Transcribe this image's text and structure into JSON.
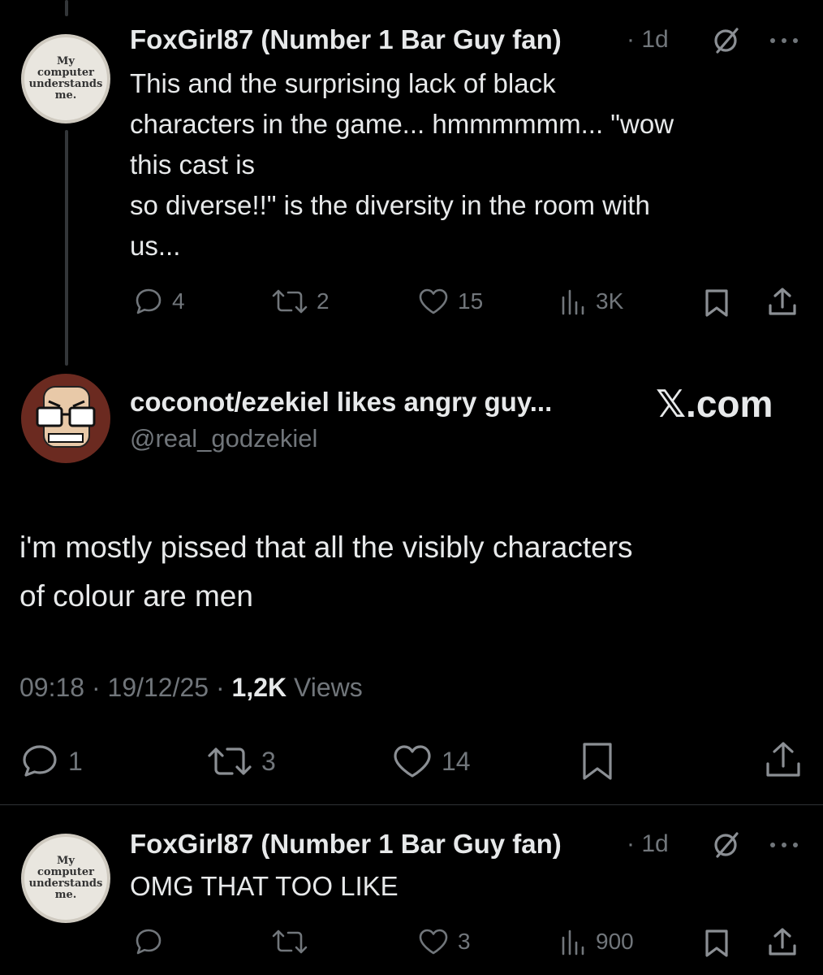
{
  "reply1": {
    "avatar_text": "My\ncomputer\nunderstands\nme.",
    "author": "FoxGirl87 (Number 1 Bar Guy fan)",
    "time": "· 1d",
    "text": "This and the surprising lack of black\ncharacters in the game... hmmmmmm... \"wow\nthis cast is\nso diverse!!\" is the diversity in the room with\nus...",
    "replies": "4",
    "reposts": "2",
    "likes": "15",
    "views": "3K"
  },
  "quoted_tweet": {
    "author": "coconot/ezekiel likes angry guy...",
    "handle": "@real_godzekiel",
    "watermark": "𝕏.com",
    "text": "i'm mostly pissed that all the visibly characters\nof colour are men",
    "timestamp": "09:18 · 19/12/25 ·",
    "views_count": "1,2K",
    "views_label": "Views",
    "replies": "1",
    "reposts": "3",
    "likes": "14"
  },
  "reply2": {
    "avatar_text": "My\ncomputer\nunderstands\nme.",
    "author": "FoxGirl87 (Number 1 Bar Guy fan)",
    "time": "· 1d",
    "text": "OMG THAT TOO LIKE",
    "replies": "",
    "reposts": "",
    "likes": "3",
    "views": "900"
  },
  "colors": {
    "background": "#000000",
    "text": "#e7e9ea",
    "muted": "#71767b",
    "divider": "#2f3336"
  }
}
